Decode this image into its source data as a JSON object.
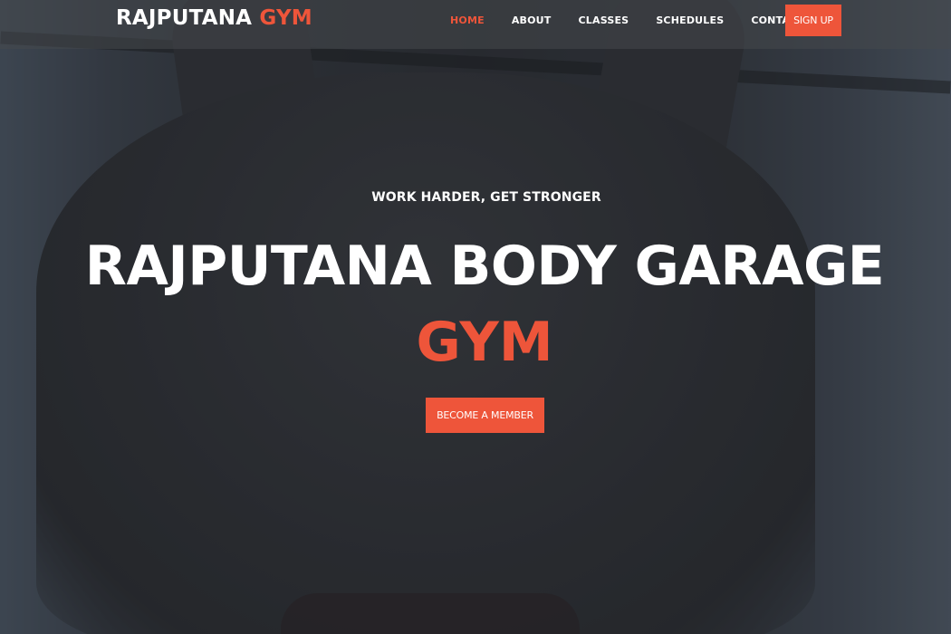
{
  "brand": {
    "name": "RAJPUTANA",
    "accent": "GYM",
    "accent_color": "#ee553a"
  },
  "nav": {
    "items": [
      {
        "label": "HOME",
        "active": true
      },
      {
        "label": "ABOUT",
        "active": false
      },
      {
        "label": "CLASSES",
        "active": false
      },
      {
        "label": "SCHEDULES",
        "active": false
      },
      {
        "label": "CONTACT",
        "active": false
      }
    ],
    "signup_label": "SIGN UP"
  },
  "hero": {
    "tagline": "WORK HARDER, GET STRONGER",
    "headline": "RAJPUTANA BODY GARAGE",
    "headline_accent": "GYM",
    "cta_label": "BECOME A MEMBER"
  }
}
